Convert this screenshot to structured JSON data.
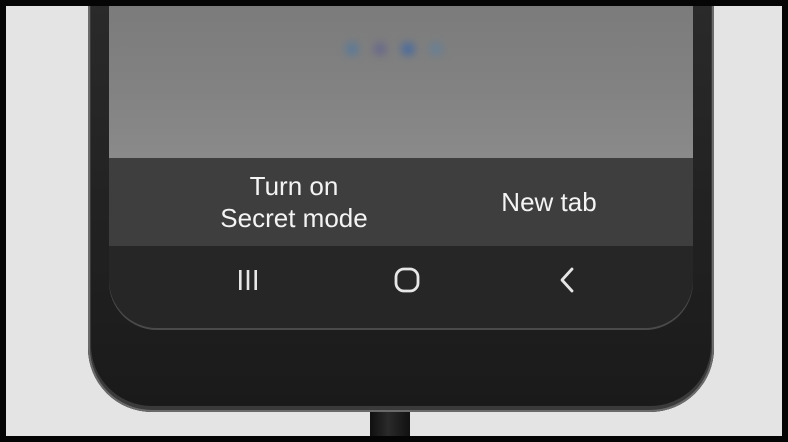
{
  "actions": {
    "secret_mode_line1": "Turn on",
    "secret_mode_line2": "Secret mode",
    "new_tab": "New tab"
  },
  "nav": {
    "recents_icon": "recents-icon",
    "home_icon": "home-icon",
    "back_icon": "back-icon"
  },
  "colors": {
    "page_background": "#e4e4e4",
    "action_bar": "#3e3e3e",
    "nav_bar": "#262626",
    "label_text": "#f4f4f4"
  }
}
